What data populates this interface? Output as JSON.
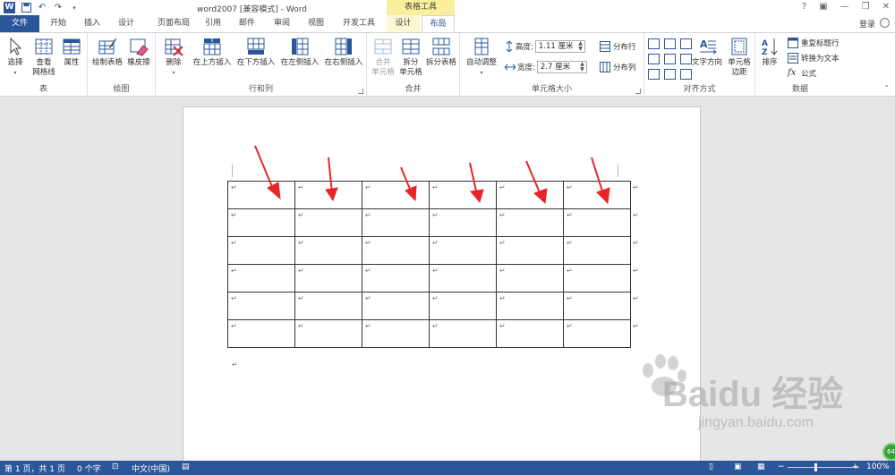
{
  "window": {
    "title": "word2007 [兼容模式] - Word",
    "context_group": "表格工具",
    "help_label": "?",
    "login": "登录"
  },
  "tabs": [
    {
      "label": "文件"
    },
    {
      "label": "开始"
    },
    {
      "label": "插入"
    },
    {
      "label": "设计"
    },
    {
      "label": "页面布局"
    },
    {
      "label": "引用"
    },
    {
      "label": "邮件"
    },
    {
      "label": "审阅"
    },
    {
      "label": "视图"
    },
    {
      "label": "开发工具"
    },
    {
      "label": "设计"
    },
    {
      "label": "布局"
    }
  ],
  "ribbon": {
    "table_group": {
      "label": "表",
      "select": "选择",
      "gridlines_line1": "查看",
      "gridlines_line2": "网格线",
      "properties": "属性"
    },
    "draw_group": {
      "label": "绘图",
      "draw_table": "绘制表格",
      "eraser": "橡皮擦"
    },
    "rows_group": {
      "label": "行和列",
      "delete": "删除",
      "insert_above": "在上方插入",
      "insert_below": "在下方插入",
      "insert_left": "在左侧插入",
      "insert_right": "在右侧插入"
    },
    "merge_group": {
      "label": "合并",
      "merge_line1": "合并",
      "merge_line2": "单元格",
      "split_line1": "拆分",
      "split_line2": "单元格",
      "split_table": "拆分表格"
    },
    "cell_size_group": {
      "label": "单元格大小",
      "autofit": "自动调整",
      "height_label": "高度:",
      "height_value": "1.11 厘米",
      "width_label": "宽度:",
      "width_value": "2.7 厘米",
      "distribute_rows": "分布行",
      "distribute_cols": "分布列"
    },
    "alignment_group": {
      "label": "对齐方式",
      "text_direction": "文字方向",
      "cell_margins_line1": "单元格",
      "cell_margins_line2": "边距"
    },
    "data_group": {
      "label": "数据",
      "sort": "排序",
      "repeat_header": "重复标题行",
      "convert_text": "转换为文本",
      "formula": "公式"
    }
  },
  "document": {
    "rows": 6,
    "cols": 6,
    "cell_mark": "↵",
    "row_end_mark": "↵",
    "paragraph_mark": "↵"
  },
  "watermark": {
    "brand": "Baidu 经验",
    "url": "jingyan.baidu.com"
  },
  "statusbar": {
    "page": "第 1 页，共 1 页",
    "words": "0 个字",
    "language": "中文(中国)",
    "zoom": "100%",
    "zoom_minus": "−",
    "zoom_plus": "+"
  },
  "badge": "64",
  "colors": {
    "accent": "#2b579a",
    "context_tab": "#f9ef9c",
    "arrow": "#e8262a"
  }
}
